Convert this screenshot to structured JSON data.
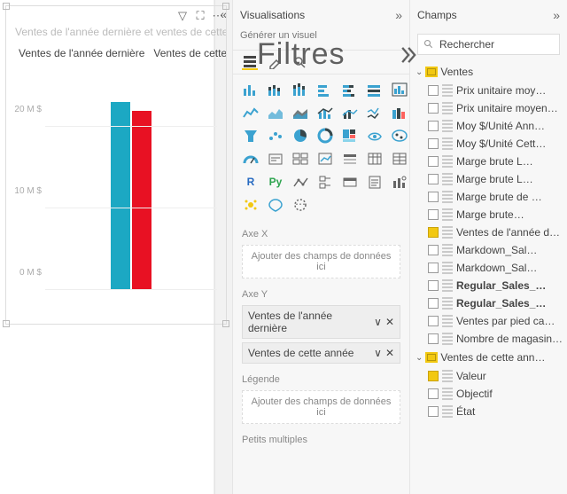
{
  "overlay": {
    "text": "Filtres",
    "chevron": "»"
  },
  "canvas": {
    "toolbar": {
      "filter": "▽",
      "focus": "⛶",
      "more": "⋯"
    },
    "chart_title": "Ventes de l'année dernière et ventes de cette année",
    "legend": {
      "s1": "Ventes de l'année dernière",
      "s2": "Ventes de cette année"
    }
  },
  "chart_data": {
    "type": "bar",
    "title": "Ventes de l'année dernière et ventes de cette année",
    "ylabel": "",
    "ylim": [
      0,
      25000000
    ],
    "yticks": [
      {
        "v": 0,
        "l": "0 M $"
      },
      {
        "v": 10000000,
        "l": "10 M $"
      },
      {
        "v": 20000000,
        "l": "20 M $"
      }
    ],
    "series": [
      {
        "name": "Ventes de l'année dernière",
        "color": "#1ca8c3",
        "value": 23000000
      },
      {
        "name": "Ventes de cette année",
        "color": "#e81123",
        "value": 22000000
      }
    ]
  },
  "vis_pane": {
    "title": "Visualisations",
    "subtitle": "Générer un visuel",
    "sections": {
      "axe_x": "Axe X",
      "axe_y": "Axe Y",
      "legende": "Légende",
      "petits": "Petits multiples"
    },
    "well_placeholder": "Ajouter des champs de données ici",
    "chips": {
      "y1": "Ventes de l'année dernière",
      "y2": "Ventes de cette année",
      "chevron": "∨",
      "close": "✕"
    },
    "tabs": {
      "fields": "⊞",
      "format": "⌁",
      "analytics": "🔍"
    }
  },
  "strip": {
    "collapse": "«",
    "expand": "»"
  },
  "fields_pane": {
    "title": "Champs",
    "search_placeholder": "Rechercher",
    "tables": [
      {
        "name": "Ventes",
        "expanded": true,
        "fields": [
          {
            "label": "Prix unitaire moy…",
            "checked": false,
            "bold": false
          },
          {
            "label": "Prix unitaire moyen…",
            "checked": false,
            "bold": false
          },
          {
            "label": "Moy $/Unité Ann…",
            "checked": false,
            "bold": false
          },
          {
            "label": "Moy $/Unité Cett…",
            "checked": false,
            "bold": false
          },
          {
            "label": "Marge brute L…",
            "checked": false,
            "bold": false
          },
          {
            "label": "Marge brute L…",
            "checked": false,
            "bold": false
          },
          {
            "label": "Marge brute de …",
            "checked": false,
            "bold": false
          },
          {
            "label": "Marge brute…",
            "checked": false,
            "bold": false
          },
          {
            "label": "Ventes de l'année d…",
            "checked": true,
            "bold": false
          },
          {
            "label": "Markdown_Sal…",
            "checked": false,
            "bold": false
          },
          {
            "label": "Markdown_Sal…",
            "checked": false,
            "bold": false
          },
          {
            "label": "Regular_Sales_…",
            "checked": false,
            "bold": true
          },
          {
            "label": "Regular_Sales_…",
            "checked": false,
            "bold": true
          },
          {
            "label": "Ventes par pied ca…",
            "checked": false,
            "bold": false
          },
          {
            "label": "Nombre de magasin…",
            "checked": false,
            "bold": false
          }
        ]
      },
      {
        "name": "Ventes de cette ann…",
        "expanded": true,
        "fields": [
          {
            "label": "Valeur",
            "checked": true,
            "bold": false
          },
          {
            "label": "Objectif",
            "checked": false,
            "bold": false
          },
          {
            "label": "État",
            "checked": false,
            "bold": false
          }
        ]
      }
    ]
  }
}
